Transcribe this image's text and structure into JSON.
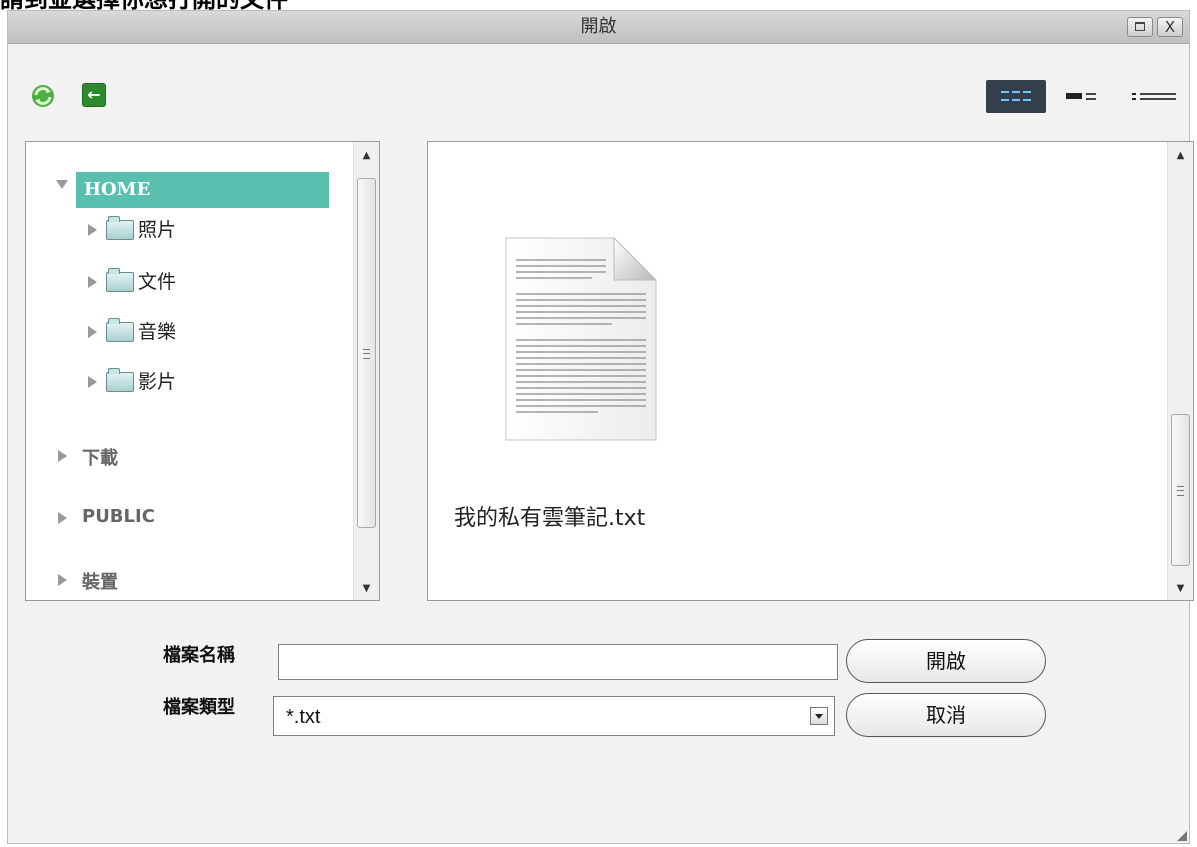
{
  "caption": "請到並選擇你想打開的文件",
  "dialog": {
    "title": "開啟",
    "window_buttons": {
      "maximize_icon": "maximize-icon",
      "close_symbol": "X"
    },
    "toolbar": {
      "refresh_icon": "refresh-icon",
      "back_icon": "back-arrow-icon",
      "back_symbol": "←",
      "views": [
        "grid-view-icon",
        "detail-view-icon",
        "list-view-icon"
      ],
      "active_view": "grid-view-icon",
      "active_color": "#33404c"
    },
    "tree": {
      "root": {
        "label": "HOME",
        "expanded": true,
        "selected": true,
        "selected_color": "#5bbfb0"
      },
      "children": [
        {
          "label": "照片"
        },
        {
          "label": "文件"
        },
        {
          "label": "音樂"
        },
        {
          "label": "影片"
        }
      ],
      "roots": [
        {
          "label": "下載"
        },
        {
          "label": "PUBLIC"
        },
        {
          "label": "裝置"
        }
      ]
    },
    "files": [
      {
        "name": "我的私有雲筆記.txt",
        "icon": "text-document-icon"
      }
    ],
    "form": {
      "filename_label": "檔案名稱",
      "filename_value": "",
      "filetype_label": "檔案類型",
      "filetype_value": "*.txt"
    },
    "buttons": {
      "open": "開啟",
      "cancel": "取消"
    }
  }
}
